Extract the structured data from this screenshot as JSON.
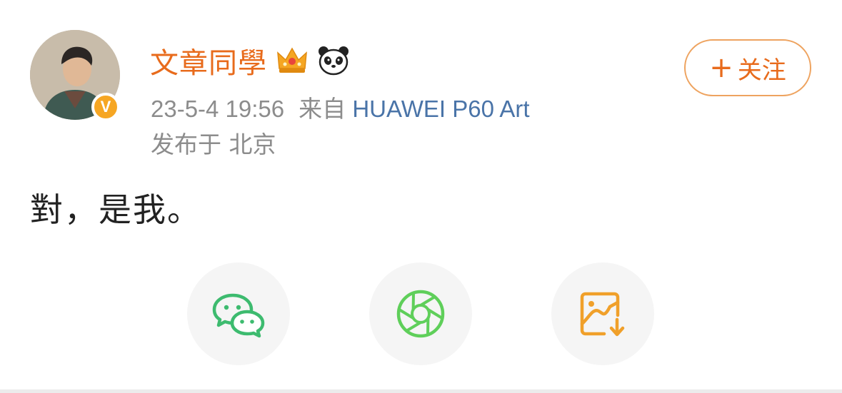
{
  "post": {
    "author": {
      "name": "文章同學",
      "verified_mark": "V",
      "badges": [
        "crown-icon",
        "panda-icon"
      ]
    },
    "time": "23-5-4 19:56",
    "source_prefix": "来自",
    "device": "HUAWEI P60 Art",
    "location": "发布于 北京",
    "text": "對，是我。",
    "follow_button": {
      "plus": "+",
      "label": "关注"
    }
  },
  "share_actions": [
    {
      "icon": "wechat-icon",
      "color": "#3dbb6f"
    },
    {
      "icon": "moments-icon",
      "color": "#5fcf5a"
    },
    {
      "icon": "save-image-icon",
      "color": "#f0a02a"
    }
  ],
  "colors": {
    "username": "#e86b1c",
    "device_link": "#4a74a8",
    "meta_text": "#8c8c8c",
    "verified_badge": "#f6a623"
  }
}
